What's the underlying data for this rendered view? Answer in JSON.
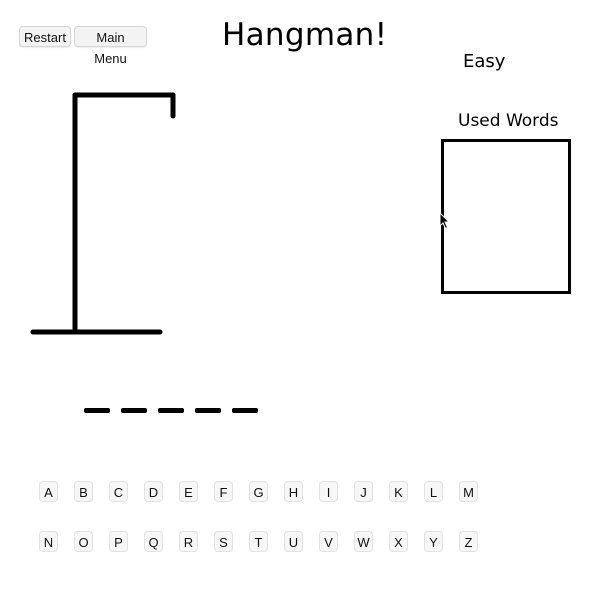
{
  "buttons": {
    "restart": "Restart",
    "main_menu": "Main Menu"
  },
  "title": "Hangman!",
  "difficulty": "Easy",
  "used_words": {
    "title": "Used Words",
    "items": []
  },
  "word": {
    "letters": [
      "",
      "",
      "",
      "",
      ""
    ]
  },
  "keyboard": {
    "row1": [
      "A",
      "B",
      "C",
      "D",
      "E",
      "F",
      "G",
      "H",
      "I",
      "J",
      "K",
      "L",
      "M"
    ],
    "row2": [
      "N",
      "O",
      "P",
      "Q",
      "R",
      "S",
      "T",
      "U",
      "V",
      "W",
      "X",
      "Y",
      "Z"
    ]
  },
  "colors": {
    "ink": "#000000",
    "button_bg": "#f3f3f3"
  }
}
